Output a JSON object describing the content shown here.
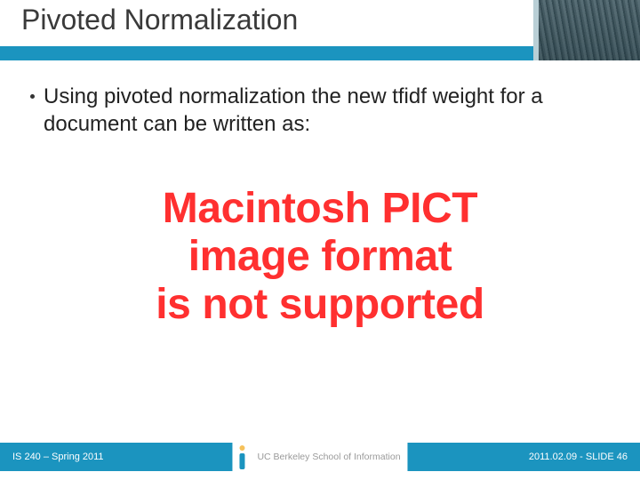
{
  "header": {
    "title": "Pivoted Normalization"
  },
  "body": {
    "bullet_text": "Using pivoted normalization the new tfidf weight for a document can be written as:"
  },
  "error": {
    "line1": "Macintosh PICT",
    "line2": "image format",
    "line3": "is not supported"
  },
  "footer": {
    "left": "IS 240 – Spring 2011",
    "center": "UC Berkeley School of Information",
    "right": "2011.02.09 - SLIDE 46"
  }
}
